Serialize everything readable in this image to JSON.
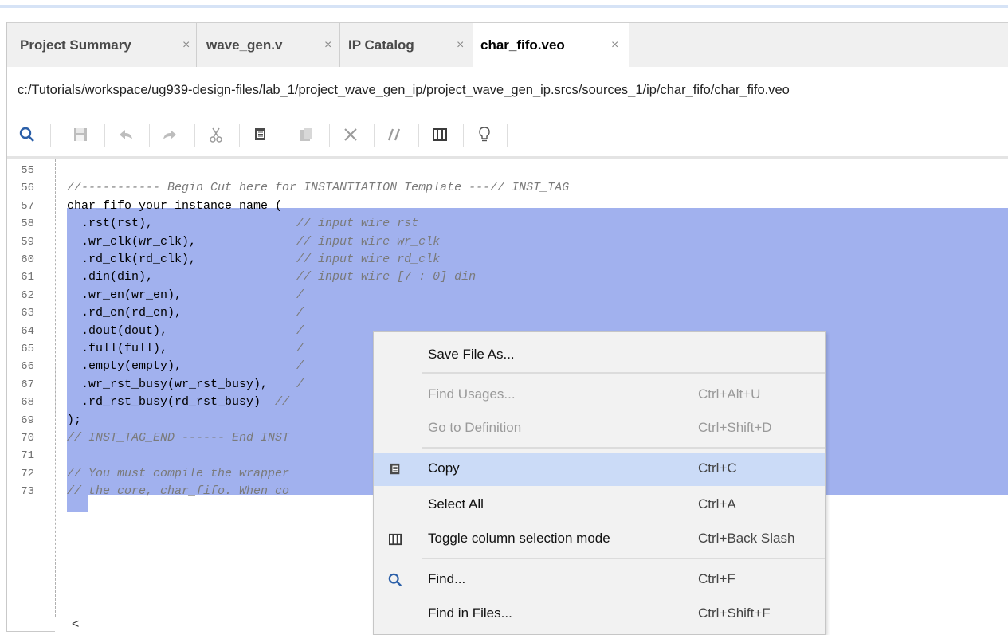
{
  "tabs": [
    {
      "label": "Project Summary",
      "close": "×",
      "active": false
    },
    {
      "label": "wave_gen.v",
      "close": "×",
      "active": false
    },
    {
      "label": "IP Catalog",
      "close": "×",
      "active": false
    },
    {
      "label": "char_fifo.veo",
      "close": "×",
      "active": true
    }
  ],
  "path": "c:/Tutorials/workspace/ug939-design-files/lab_1/project_wave_gen_ip/project_wave_gen_ip.srcs/sources_1/ip/char_fifo/char_fifo.veo",
  "toolbar_icons": [
    "search-icon",
    "save-icon",
    "undo-icon",
    "redo-icon",
    "cut-icon",
    "copy-icon",
    "paste-icon",
    "delete-icon",
    "comment-icon",
    "column-select-icon",
    "lightbulb-icon"
  ],
  "editor": {
    "lines": [
      {
        "n": "55",
        "code": "",
        "comment": ""
      },
      {
        "n": "56",
        "code": "",
        "comment": "//----------- Begin Cut here for INSTANTIATION Template ---// INST_TAG"
      },
      {
        "n": "57",
        "code": "char_fifo your_instance_name (",
        "comment": ""
      },
      {
        "n": "58",
        "code": "  .rst(rst),                    ",
        "comment": "// input wire rst"
      },
      {
        "n": "59",
        "code": "  .wr_clk(wr_clk),              ",
        "comment": "// input wire wr_clk"
      },
      {
        "n": "60",
        "code": "  .rd_clk(rd_clk),              ",
        "comment": "// input wire rd_clk"
      },
      {
        "n": "61",
        "code": "  .din(din),                    ",
        "comment": "// input wire [7 : 0] din"
      },
      {
        "n": "62",
        "code": "  .wr_en(wr_en),                ",
        "comment": "/"
      },
      {
        "n": "63",
        "code": "  .rd_en(rd_en),                ",
        "comment": "/"
      },
      {
        "n": "64",
        "code": "  .dout(dout),                  ",
        "comment": "/"
      },
      {
        "n": "65",
        "code": "  .full(full),                  ",
        "comment": "/"
      },
      {
        "n": "66",
        "code": "  .empty(empty),                ",
        "comment": "/"
      },
      {
        "n": "67",
        "code": "  .wr_rst_busy(wr_rst_busy),    ",
        "comment": "/"
      },
      {
        "n": "68",
        "code": "  .rd_rst_busy(rd_rst_busy)  ",
        "comment": "//"
      },
      {
        "n": "69",
        "code": ");",
        "comment": ""
      },
      {
        "n": "70",
        "code": "",
        "comment": "// INST_TAG_END ------ End INST"
      },
      {
        "n": "71",
        "code": "",
        "comment": ""
      },
      {
        "n": "72",
        "code": "",
        "comment": "// You must compile the wrapper"
      },
      {
        "n": "73",
        "code": "",
        "comment": "// the core, char_fifo. When co"
      }
    ],
    "hscroll_arrow": "<"
  },
  "context_menu": {
    "items": [
      {
        "label": "Save File As...",
        "shortcut": "",
        "disabled": false,
        "icon": ""
      },
      {
        "label": "Find Usages...",
        "shortcut": "Ctrl+Alt+U",
        "disabled": true,
        "icon": ""
      },
      {
        "label": "Go to Definition",
        "shortcut": "Ctrl+Shift+D",
        "disabled": true,
        "icon": ""
      },
      {
        "label": "Copy",
        "shortcut": "Ctrl+C",
        "disabled": false,
        "icon": "copy-icon"
      },
      {
        "label": "Select All",
        "shortcut": "Ctrl+A",
        "disabled": false,
        "icon": ""
      },
      {
        "label": "Toggle column selection mode",
        "shortcut": "Ctrl+Back Slash",
        "disabled": false,
        "icon": "column-select-icon"
      },
      {
        "label": "Find...",
        "shortcut": "Ctrl+F",
        "disabled": false,
        "icon": "search-icon"
      },
      {
        "label": "Find in Files...",
        "shortcut": "Ctrl+Shift+F",
        "disabled": false,
        "icon": ""
      }
    ]
  },
  "colors": {
    "selection": "#a1b1ee",
    "menu_highlight": "#cbdbf7",
    "accent": "#2b5fa8"
  }
}
